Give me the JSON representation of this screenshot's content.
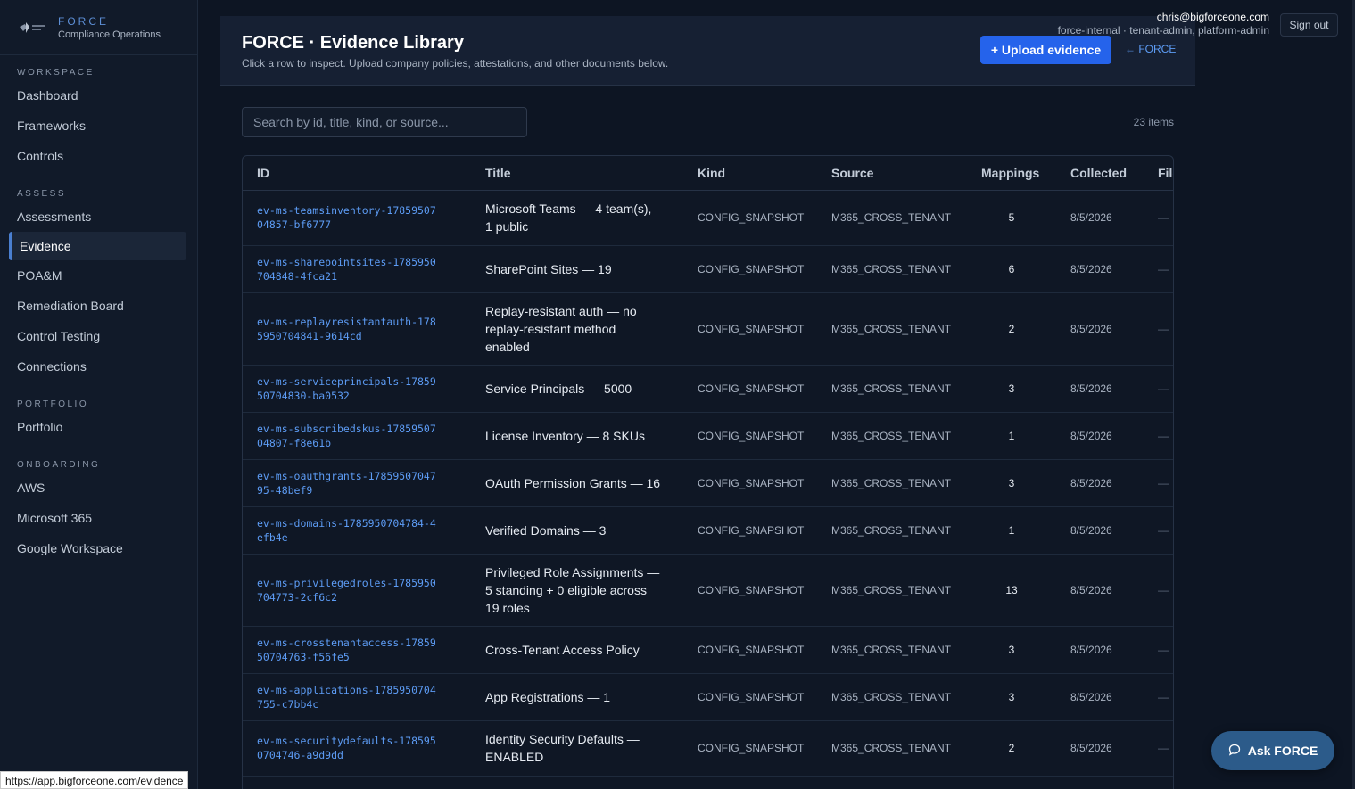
{
  "brand": {
    "name": "FORCE",
    "subtitle": "Compliance Operations"
  },
  "sidebar": {
    "sections": [
      {
        "label": "WORKSPACE",
        "items": [
          "Dashboard",
          "Frameworks",
          "Controls"
        ]
      },
      {
        "label": "ASSESS",
        "items": [
          "Assessments",
          "Evidence",
          "POA&M",
          "Remediation Board",
          "Control Testing",
          "Connections"
        ]
      },
      {
        "label": "PORTFOLIO",
        "items": [
          "Portfolio"
        ]
      },
      {
        "label": "ONBOARDING",
        "items": [
          "AWS",
          "Microsoft 365",
          "Google Workspace"
        ]
      }
    ],
    "active": "Evidence"
  },
  "user": {
    "email": "chris@bigforceone.com",
    "roles": "force-internal · tenant-admin, platform-admin",
    "signout_label": "Sign out"
  },
  "header": {
    "title": "FORCE · Evidence Library",
    "description": "Click a row to inspect. Upload company policies, attestations, and other documents below.",
    "upload_label": "+ Upload evidence",
    "back_label": "← FORCE"
  },
  "search": {
    "placeholder": "Search by id, title, kind, or source...",
    "count": "23 items"
  },
  "table": {
    "columns": [
      "ID",
      "Title",
      "Kind",
      "Source",
      "Mappings",
      "Collected",
      "Files"
    ],
    "rows": [
      {
        "id": "ev-ms-teamsinventory-1785950704857-bf6777",
        "title": "Microsoft Teams — 4 team(s), 1 public",
        "kind": "CONFIG_SNAPSHOT",
        "source": "M365_CROSS_TENANT",
        "mappings": "5",
        "collected": "8/5/2026",
        "files": "—"
      },
      {
        "id": "ev-ms-sharepointsites-1785950704848-4fca21",
        "title": "SharePoint Sites — 19",
        "kind": "CONFIG_SNAPSHOT",
        "source": "M365_CROSS_TENANT",
        "mappings": "6",
        "collected": "8/5/2026",
        "files": "—"
      },
      {
        "id": "ev-ms-replayresistantauth-1785950704841-9614cd",
        "title": "Replay-resistant auth — no replay-resistant method enabled",
        "kind": "CONFIG_SNAPSHOT",
        "source": "M365_CROSS_TENANT",
        "mappings": "2",
        "collected": "8/5/2026",
        "files": "—"
      },
      {
        "id": "ev-ms-serviceprincipals-1785950704830-ba0532",
        "title": "Service Principals — 5000",
        "kind": "CONFIG_SNAPSHOT",
        "source": "M365_CROSS_TENANT",
        "mappings": "3",
        "collected": "8/5/2026",
        "files": "—"
      },
      {
        "id": "ev-ms-subscribedskus-1785950704807-f8e61b",
        "title": "License Inventory — 8 SKUs",
        "kind": "CONFIG_SNAPSHOT",
        "source": "M365_CROSS_TENANT",
        "mappings": "1",
        "collected": "8/5/2026",
        "files": "—"
      },
      {
        "id": "ev-ms-oauthgrants-1785950704795-48bef9",
        "title": "OAuth Permission Grants — 16",
        "kind": "CONFIG_SNAPSHOT",
        "source": "M365_CROSS_TENANT",
        "mappings": "3",
        "collected": "8/5/2026",
        "files": "—"
      },
      {
        "id": "ev-ms-domains-1785950704784-4efb4e",
        "title": "Verified Domains — 3",
        "kind": "CONFIG_SNAPSHOT",
        "source": "M365_CROSS_TENANT",
        "mappings": "1",
        "collected": "8/5/2026",
        "files": "—"
      },
      {
        "id": "ev-ms-privilegedroles-1785950704773-2cf6c2",
        "title": "Privileged Role Assignments — 5 standing + 0 eligible across 19 roles",
        "kind": "CONFIG_SNAPSHOT",
        "source": "M365_CROSS_TENANT",
        "mappings": "13",
        "collected": "8/5/2026",
        "files": "—"
      },
      {
        "id": "ev-ms-crosstenantaccess-1785950704763-f56fe5",
        "title": "Cross-Tenant Access Policy",
        "kind": "CONFIG_SNAPSHOT",
        "source": "M365_CROSS_TENANT",
        "mappings": "3",
        "collected": "8/5/2026",
        "files": "—"
      },
      {
        "id": "ev-ms-applications-1785950704755-c7bb4c",
        "title": "App Registrations — 1",
        "kind": "CONFIG_SNAPSHOT",
        "source": "M365_CROSS_TENANT",
        "mappings": "3",
        "collected": "8/5/2026",
        "files": "—"
      },
      {
        "id": "ev-ms-securitydefaults-1785950704746-a9d9dd",
        "title": "Identity Security Defaults — ENABLED",
        "kind": "CONFIG_SNAPSHOT",
        "source": "M365_CROSS_TENANT",
        "mappings": "2",
        "collected": "8/5/2026",
        "files": "—"
      }
    ]
  },
  "statusbar": {
    "url": "https://app.bigforceone.com/evidence"
  },
  "ask": {
    "label": "Ask FORCE"
  }
}
